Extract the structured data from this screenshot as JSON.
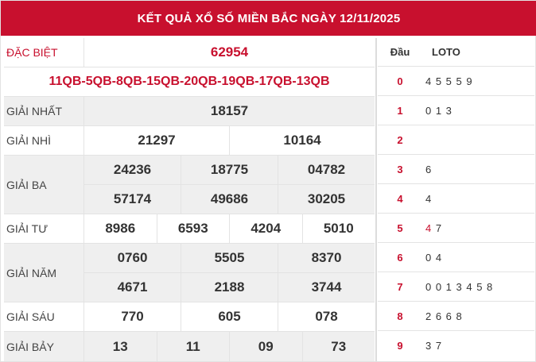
{
  "header": {
    "title": "KẾT QUẢ XỔ SỐ MIỀN BẮC NGÀY 12/11/2025"
  },
  "prizes": {
    "special": {
      "label": "ĐẶC BIỆT",
      "value": "62954"
    },
    "codes": "11QB-5QB-8QB-15QB-20QB-19QB-17QB-13QB",
    "first": {
      "label": "GIẢI NHẤT",
      "values": [
        "18157"
      ]
    },
    "second": {
      "label": "GIẢI NHÌ",
      "values": [
        "21297",
        "10164"
      ]
    },
    "third": {
      "label": "GIẢI BA",
      "values": [
        "24236",
        "18775",
        "04782",
        "57174",
        "49686",
        "30205"
      ]
    },
    "fourth": {
      "label": "GIẢI TƯ",
      "values": [
        "8986",
        "6593",
        "4204",
        "5010"
      ]
    },
    "fifth": {
      "label": "GIẢI NĂM",
      "values": [
        "0760",
        "5505",
        "8370",
        "4671",
        "2188",
        "3744"
      ]
    },
    "sixth": {
      "label": "GIẢI SÁU",
      "values": [
        "770",
        "605",
        "078"
      ]
    },
    "seventh": {
      "label": "GIẢI BẢY",
      "values": [
        "13",
        "11",
        "09",
        "73"
      ]
    }
  },
  "loto": {
    "head_label": "Đầu",
    "loto_label": "LOTO",
    "rows": [
      {
        "head": "0",
        "values": "4 5 5 5 9"
      },
      {
        "head": "1",
        "values": "0 1 3"
      },
      {
        "head": "2",
        "values": ""
      },
      {
        "head": "3",
        "values": "6"
      },
      {
        "head": "4",
        "values": "4"
      },
      {
        "head": "5",
        "values": "7",
        "highlight": "4"
      },
      {
        "head": "6",
        "values": "0 4"
      },
      {
        "head": "7",
        "values": "0 0 1 3 4 5 8"
      },
      {
        "head": "8",
        "values": "2 6 6 8"
      },
      {
        "head": "9",
        "values": "3 7"
      }
    ]
  },
  "colors": {
    "accent": "#c8102e",
    "shade": "#efefef",
    "border": "#e3e3e3"
  }
}
